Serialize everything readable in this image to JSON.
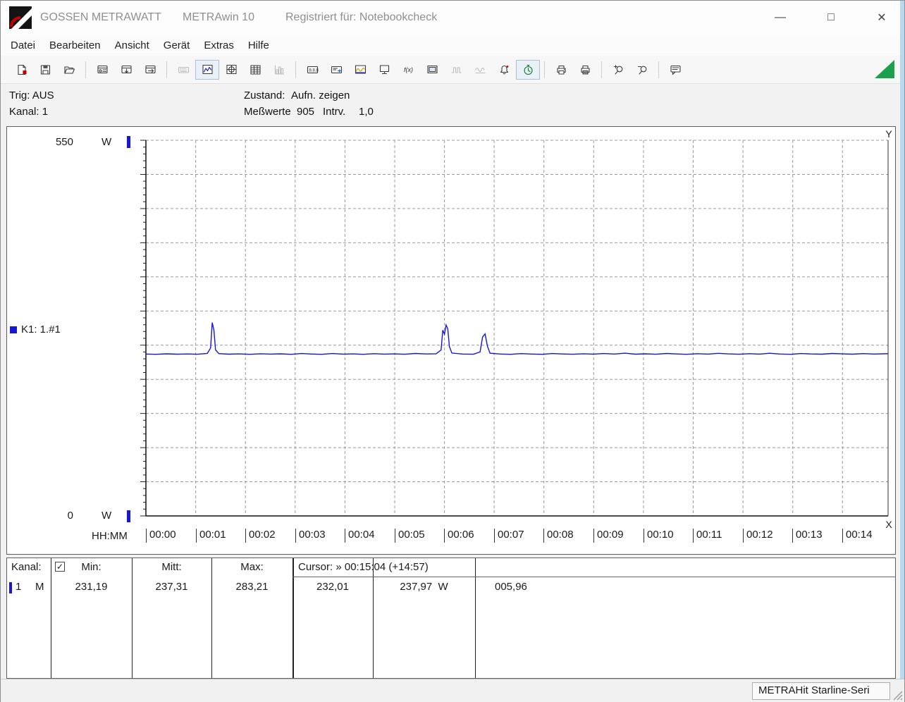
{
  "window": {
    "title_brand": "GOSSEN METRAWATT",
    "title_app": "METRAwin 10",
    "title_registered": "Registriert für: Notebookcheck",
    "controls": {
      "minimize": "—",
      "maximize": "□",
      "close": "✕"
    }
  },
  "menu": {
    "items": [
      "Datei",
      "Bearbeiten",
      "Ansicht",
      "Gerät",
      "Extras",
      "Hilfe"
    ]
  },
  "toolbar": {
    "buttons": [
      "file-new",
      "file-save",
      "folder-open",
      "multimeter-window",
      "multimeter-read",
      "multimeter-send",
      "keyboard",
      "line-chart-view",
      "crosshair-view",
      "table-view",
      "histogram-view",
      "display-values",
      "display-config",
      "scope-display",
      "monitor",
      "formula",
      "display-screen",
      "signal-steps",
      "signal-wave",
      "alarm",
      "timer",
      "print",
      "print-form",
      "zoom-in",
      "zoom-out",
      "note"
    ],
    "active": [
      "line-chart-view",
      "timer"
    ],
    "disabled": [
      "keyboard",
      "histogram-view",
      "signal-steps",
      "signal-wave"
    ]
  },
  "status": {
    "trig": "Trig: AUS",
    "kanal": "Kanal: 1",
    "zustand_label": "Zustand:",
    "zustand_value": "Aufn. zeigen",
    "messwerte_label": "Meßwerte",
    "messwerte_value": "905",
    "intrv_label": "Intrv.",
    "intrv_value": "1,0"
  },
  "chart": {
    "y_axis": {
      "max": "550",
      "min": "0",
      "unit": "W"
    },
    "channel_label": "K1: 1.#1",
    "x_axis_label": "HH:MM",
    "x_ticks": [
      "00:00",
      "00:01",
      "00:02",
      "00:03",
      "00:04",
      "00:05",
      "00:06",
      "00:07",
      "00:08",
      "00:09",
      "00:10",
      "00:11",
      "00:12",
      "00:13",
      "00:14"
    ],
    "cursor_handle_top": "Y",
    "cursor_handle_bottom": "X",
    "colors": {
      "line": "#1616d6",
      "grid": "#9a9a9a",
      "channel_marker": "#1616d6"
    }
  },
  "chart_data": {
    "type": "line",
    "title": "",
    "xlabel": "HH:MM",
    "ylabel": "W",
    "ylim": [
      0,
      550
    ],
    "x_seconds_range": [
      0,
      895
    ],
    "grid": true,
    "y_grid_step_w": 50,
    "x_grid_step_s": 60,
    "series": [
      {
        "name": "K1: 1.#1",
        "color": "#1616d6",
        "points": [
          [
            0,
            237.0
          ],
          [
            12,
            236.6
          ],
          [
            25,
            237.3
          ],
          [
            38,
            236.8
          ],
          [
            50,
            237.1
          ],
          [
            62,
            236.7
          ],
          [
            74,
            237.9
          ],
          [
            78,
            246.0
          ],
          [
            80,
            283.2
          ],
          [
            82,
            272.0
          ],
          [
            84,
            243.0
          ],
          [
            88,
            237.6
          ],
          [
            100,
            236.8
          ],
          [
            112,
            237.2
          ],
          [
            125,
            236.6
          ],
          [
            138,
            237.4
          ],
          [
            150,
            236.9
          ],
          [
            162,
            237.3
          ],
          [
            175,
            236.6
          ],
          [
            188,
            237.7
          ],
          [
            200,
            237.0
          ],
          [
            212,
            236.6
          ],
          [
            225,
            237.8
          ],
          [
            238,
            236.9
          ],
          [
            250,
            237.2
          ],
          [
            262,
            236.6
          ],
          [
            275,
            237.5
          ],
          [
            288,
            236.9
          ],
          [
            300,
            237.2
          ],
          [
            312,
            236.7
          ],
          [
            325,
            237.9
          ],
          [
            338,
            237.1
          ],
          [
            350,
            237.4
          ],
          [
            356,
            243.0
          ],
          [
            358,
            272.0
          ],
          [
            360,
            266.0
          ],
          [
            362,
            279.5
          ],
          [
            364,
            274.0
          ],
          [
            366,
            248.0
          ],
          [
            369,
            238.5
          ],
          [
            382,
            237.0
          ],
          [
            395,
            236.7
          ],
          [
            403,
            240.0
          ],
          [
            406,
            262.0
          ],
          [
            409,
            266.5
          ],
          [
            412,
            248.0
          ],
          [
            415,
            238.2
          ],
          [
            428,
            237.0
          ],
          [
            440,
            236.6
          ],
          [
            452,
            237.6
          ],
          [
            465,
            237.0
          ],
          [
            478,
            236.6
          ],
          [
            490,
            237.8
          ],
          [
            502,
            237.1
          ],
          [
            515,
            236.7
          ],
          [
            528,
            237.4
          ],
          [
            540,
            236.9
          ],
          [
            552,
            237.7
          ],
          [
            565,
            237.0
          ],
          [
            578,
            238.3
          ],
          [
            590,
            236.8
          ],
          [
            602,
            237.3
          ],
          [
            615,
            236.7
          ],
          [
            628,
            237.9
          ],
          [
            640,
            237.1
          ],
          [
            652,
            236.6
          ],
          [
            665,
            237.5
          ],
          [
            678,
            236.9
          ],
          [
            690,
            238.1
          ],
          [
            702,
            237.2
          ],
          [
            715,
            236.7
          ],
          [
            728,
            237.5
          ],
          [
            740,
            236.9
          ],
          [
            752,
            238.2
          ],
          [
            765,
            237.0
          ],
          [
            778,
            236.6
          ],
          [
            790,
            237.7
          ],
          [
            802,
            237.1
          ],
          [
            815,
            236.8
          ],
          [
            828,
            237.9
          ],
          [
            840,
            237.2
          ],
          [
            852,
            236.8
          ],
          [
            865,
            237.6
          ],
          [
            878,
            237.0
          ],
          [
            888,
            237.3
          ],
          [
            895,
            237.5
          ]
        ]
      }
    ]
  },
  "table": {
    "kanal_header": "Kanal:",
    "checkbox_glyph": "✓",
    "min_header": "Min:",
    "mitt_header": "Mitt:",
    "max_header": "Max:",
    "cursor_header": "Cursor: » 00:15:04 (+14:57)",
    "row": {
      "channel": "1",
      "mode": "M",
      "min": "231,19",
      "mitt": "237,31",
      "max": "283,21",
      "cursor_val1": "232,01",
      "cursor_val2": "237,97",
      "cursor_unit": "W",
      "cursor_delta": "005,96"
    }
  },
  "statusbar": {
    "device": "METRAHit Starline-Seri"
  }
}
